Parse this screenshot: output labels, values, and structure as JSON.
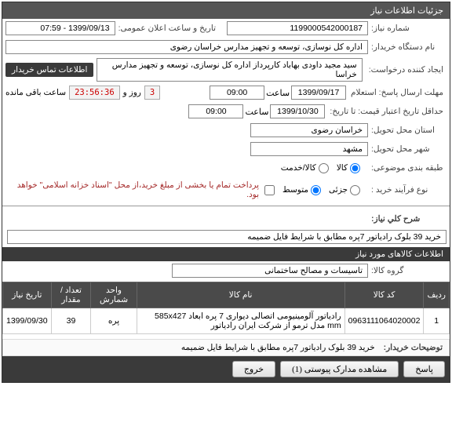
{
  "header": {
    "title": "جزئیات اطلاعات نیاز"
  },
  "fields": {
    "need_number_label": "شماره نیاز:",
    "need_number": "1199000542000187",
    "announce_label": "تاریخ و ساعت اعلان عمومی:",
    "announce_value": "1399/09/13 - 07:59",
    "buyer_org_label": "نام دستگاه خریدار:",
    "buyer_org": "اداره کل نوسازی، توسعه و تجهیز مدارس خراسان رضوی",
    "creator_label": "ایجاد کننده درخواست:",
    "creator": "سید مجید داودی بهاباد کارپرداز اداره کل نوسازی، توسعه و تجهیز مدارس خراسا",
    "contact_button": "اطلاعات تماس خریدار",
    "deadline_label": "مهلت ارسال پاسخ: استعلام",
    "deadline_date": "1399/09/17",
    "deadline_hour_label": "ساعت",
    "deadline_hour": "09:00",
    "remaining_label": "ساعت باقی مانده",
    "remaining_days": "3",
    "remaining_days_label": "روز و",
    "remaining_time": "23:56:36",
    "validity_label": "حداقل تاریخ اعتبار قیمت: تا تاریخ:",
    "validity_date": "1399/10/30",
    "validity_hour": "09:00",
    "province_label": "استان محل تحویل:",
    "province": "خراسان رضوی",
    "city_label": "شهر محل تحویل:",
    "city": "مشهد",
    "category_label": "طبقه بندی موضوعی:",
    "cat_goods": "کالا",
    "cat_service": "کالا/خدمت",
    "process_label": "نوع فرآیند خرید :",
    "proc_low": "جزئی",
    "proc_mid": "متوسط",
    "payment_note": "پرداخت تمام یا بخشی از مبلغ خرید،از محل \"اسناد خزانه اسلامی\" خواهد بود.",
    "summary_label": "شرح کلي نياز:",
    "summary": "خرید 39 بلوک رادیاتور 7پره مطابق با شرایط فایل ضمیمه",
    "goods_section": "اطلاعات کالاهای مورد نیاز",
    "group_label": "گروه کالا:",
    "group": "تاسیسات و مصالح ساختمانی",
    "buyer_desc_label": "توضیحات خریدار:",
    "buyer_desc": "خرید 39 بلوک رادیاتور 7پره مطابق با شرایط فایل ضمیمه"
  },
  "table": {
    "headers": {
      "row": "ردیف",
      "code": "کد کالا",
      "name": "نام کالا",
      "unit": "واحد شمارش",
      "qty": "تعداد / مقدار",
      "date": "تاریخ نیاز"
    },
    "rows": [
      {
        "row": "1",
        "code": "0963111064020002",
        "name": "رادیاتور آلومینیومی اتصالی دیواری 7 پره ابعاد 585x427 mm مدل ترمو از شرکت ایران رادیاتور",
        "unit": "پره",
        "qty": "39",
        "date": "1399/09/30"
      }
    ]
  },
  "buttons": {
    "reply": "پاسخ",
    "attachments": "مشاهده مدارک پیوستی (1)",
    "exit": "خروج"
  }
}
